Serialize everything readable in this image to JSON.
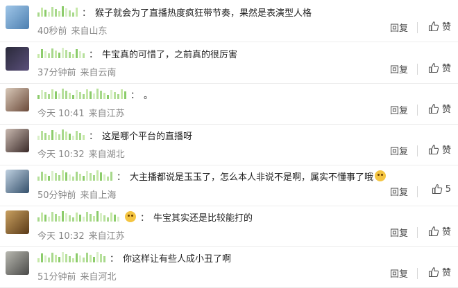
{
  "comments": [
    {
      "text": "猴子就会为了直播热度疯狂带节奏，果然是表演型人格",
      "time": "40秒前",
      "location": "来自山东",
      "reply_label": "回复",
      "like_label": "赞",
      "avatar_colors": [
        "#9fc6e8",
        "#4d7fb0"
      ]
    },
    {
      "text": "牛宝真的可惜了，之前真的很厉害",
      "time": "37分钟前",
      "location": "来自云南",
      "reply_label": "回复",
      "like_label": "赞",
      "avatar_colors": [
        "#2a2a3a",
        "#5a4f7a"
      ]
    },
    {
      "text": "。",
      "time": "今天 10:41",
      "location": "来自江苏",
      "reply_label": "回复",
      "like_label": "赞",
      "avatar_colors": [
        "#d8c8b8",
        "#6b4a3a"
      ]
    },
    {
      "text": "这是哪个平台的直播呀",
      "time": "今天 10:32",
      "location": "来自湖北",
      "reply_label": "回复",
      "like_label": "赞",
      "avatar_colors": [
        "#c9b9b0",
        "#3a2a28"
      ]
    },
    {
      "text": "大主播都说是玉玉了，怎么本人非说不是啊，属实不懂事了哦",
      "time": "50分钟前",
      "location": "来自上海",
      "reply_label": "回复",
      "like_label": "5",
      "avatar_colors": [
        "#bfd0e0",
        "#34506b"
      ]
    },
    {
      "text": "牛宝其实还是比较能打的",
      "time": "今天 10:32",
      "location": "来自江苏",
      "reply_label": "回复",
      "like_label": "赞",
      "avatar_colors": [
        "#c9a060",
        "#5a3a18"
      ]
    },
    {
      "text": "你这样让有些人成小丑了啊",
      "time": "51分钟前",
      "location": "来自河北",
      "reply_label": "回复",
      "like_label": "赞",
      "avatar_colors": [
        "#b8b8b0",
        "#4a4a48"
      ]
    }
  ]
}
